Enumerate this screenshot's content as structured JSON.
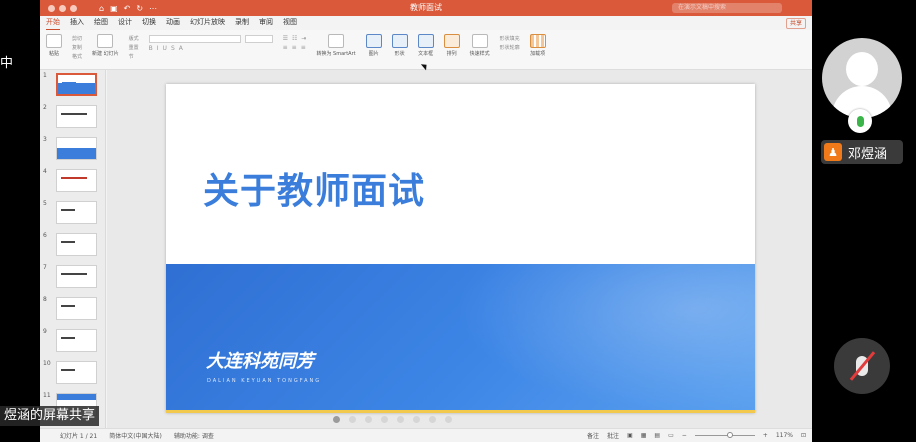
{
  "window": {
    "title": "教师面试",
    "search_placeholder": "在演示文稿中搜索"
  },
  "menu": {
    "tabs": [
      "开始",
      "插入",
      "绘图",
      "设计",
      "切换",
      "动画",
      "幻灯片放映",
      "录制",
      "审阅",
      "视图"
    ],
    "active_tab": "开始",
    "share_label": "共享"
  },
  "ribbon": {
    "paste": "粘贴",
    "cut": "剪切",
    "copy": "复制",
    "format": "格式",
    "new_slide": "新建\n幻灯片",
    "layout": "版式",
    "reset": "重置",
    "section": "节",
    "convert_smartart": "转换为\nSmartArt",
    "picture": "图片",
    "shapes": "形状",
    "textbox": "文本框",
    "arrange": "排列",
    "quick_styles": "快速样式",
    "shape_fill": "形状填充",
    "shape_outline": "形状轮廓",
    "addins": "加载项"
  },
  "thumbnails": [
    "1",
    "2",
    "3",
    "4",
    "5",
    "6",
    "7",
    "8",
    "9",
    "10",
    "11"
  ],
  "slide": {
    "title": "关于教师面试",
    "brand": "大连科苑同芳",
    "brand_sub": "DALIAN KEYUAN TONGFANG"
  },
  "status": {
    "slide_count": "幻灯片 1 / 21",
    "language": "简体中文(中国大陆)",
    "accessibility": "辅助功能: 调查",
    "notes": "备注",
    "comments": "批注",
    "zoom": "117%"
  },
  "meeting": {
    "participant_name": "邓煜涵",
    "share_caption": "煜涵的屏幕共享",
    "left_char": "中"
  }
}
